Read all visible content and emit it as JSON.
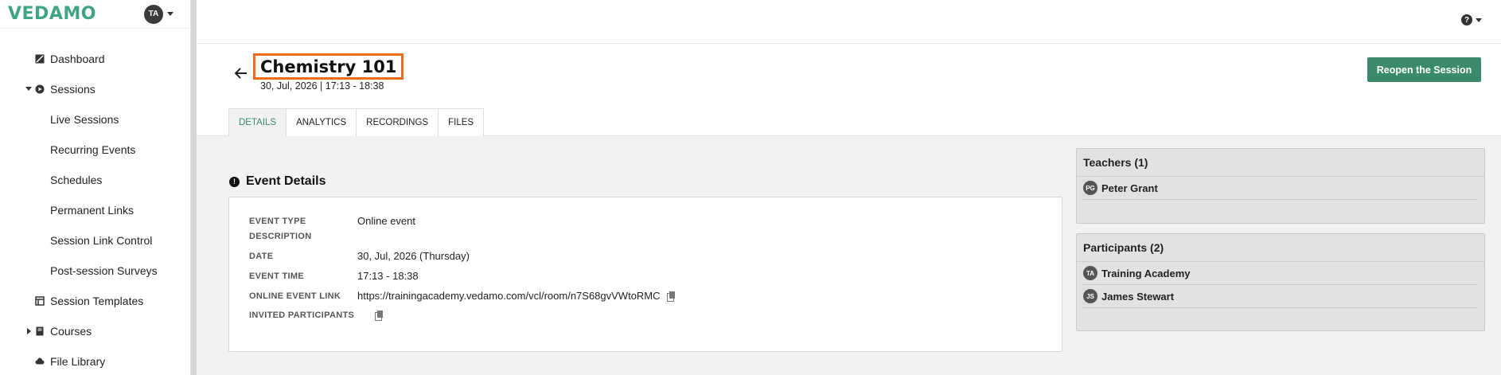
{
  "app": {
    "logo_text": "VEDAMO",
    "brand_color": "#3fa580",
    "user_initials": "TA"
  },
  "sidebar": {
    "items": [
      {
        "label": "Dashboard",
        "icon": "dashboard-icon"
      },
      {
        "label": "Sessions",
        "icon": "play-circle-icon",
        "expanded": true
      },
      {
        "label": "Live Sessions"
      },
      {
        "label": "Recurring Events"
      },
      {
        "label": "Schedules"
      },
      {
        "label": "Permanent Links"
      },
      {
        "label": "Session Link Control"
      },
      {
        "label": "Post-session Surveys"
      },
      {
        "label": "Session Templates",
        "icon": "template-icon"
      },
      {
        "label": "Courses",
        "icon": "book-icon",
        "expanded": false
      },
      {
        "label": "File Library",
        "icon": "cloud-icon"
      }
    ]
  },
  "header": {
    "title": "Chemistry 101",
    "subtitle": "30, Jul, 2026 | 17:13 - 18:38",
    "reopen_label": "Reopen the Session",
    "accent_color": "#3c8a6c",
    "highlight_color": "#ec6b1d"
  },
  "tabs": [
    {
      "label": "DETAILS",
      "active": true
    },
    {
      "label": "ANALYTICS"
    },
    {
      "label": "RECORDINGS"
    },
    {
      "label": "FILES"
    }
  ],
  "event_details": {
    "section_title": "Event Details",
    "rows": [
      {
        "label": "EVENT TYPE",
        "value": "Online event"
      },
      {
        "label": "DESCRIPTION",
        "value": ""
      },
      {
        "label": "DATE",
        "value": "30, Jul, 2026 (Thursday)"
      },
      {
        "label": "EVENT TIME",
        "value": "17:13 - 18:38"
      },
      {
        "label": "ONLINE EVENT LINK",
        "value": "https://trainingacademy.vedamo.com/vcl/room/n7S68gvVWtoRMC"
      },
      {
        "label": "INVITED PARTICIPANTS",
        "value": ""
      }
    ]
  },
  "teachers": {
    "title": "Teachers (1)",
    "people": [
      {
        "initials": "PG",
        "name": "Peter Grant"
      }
    ]
  },
  "participants": {
    "title": "Participants (2)",
    "people": [
      {
        "initials": "TA",
        "name": "Training Academy"
      },
      {
        "initials": "JS",
        "name": "James Stewart"
      }
    ]
  }
}
